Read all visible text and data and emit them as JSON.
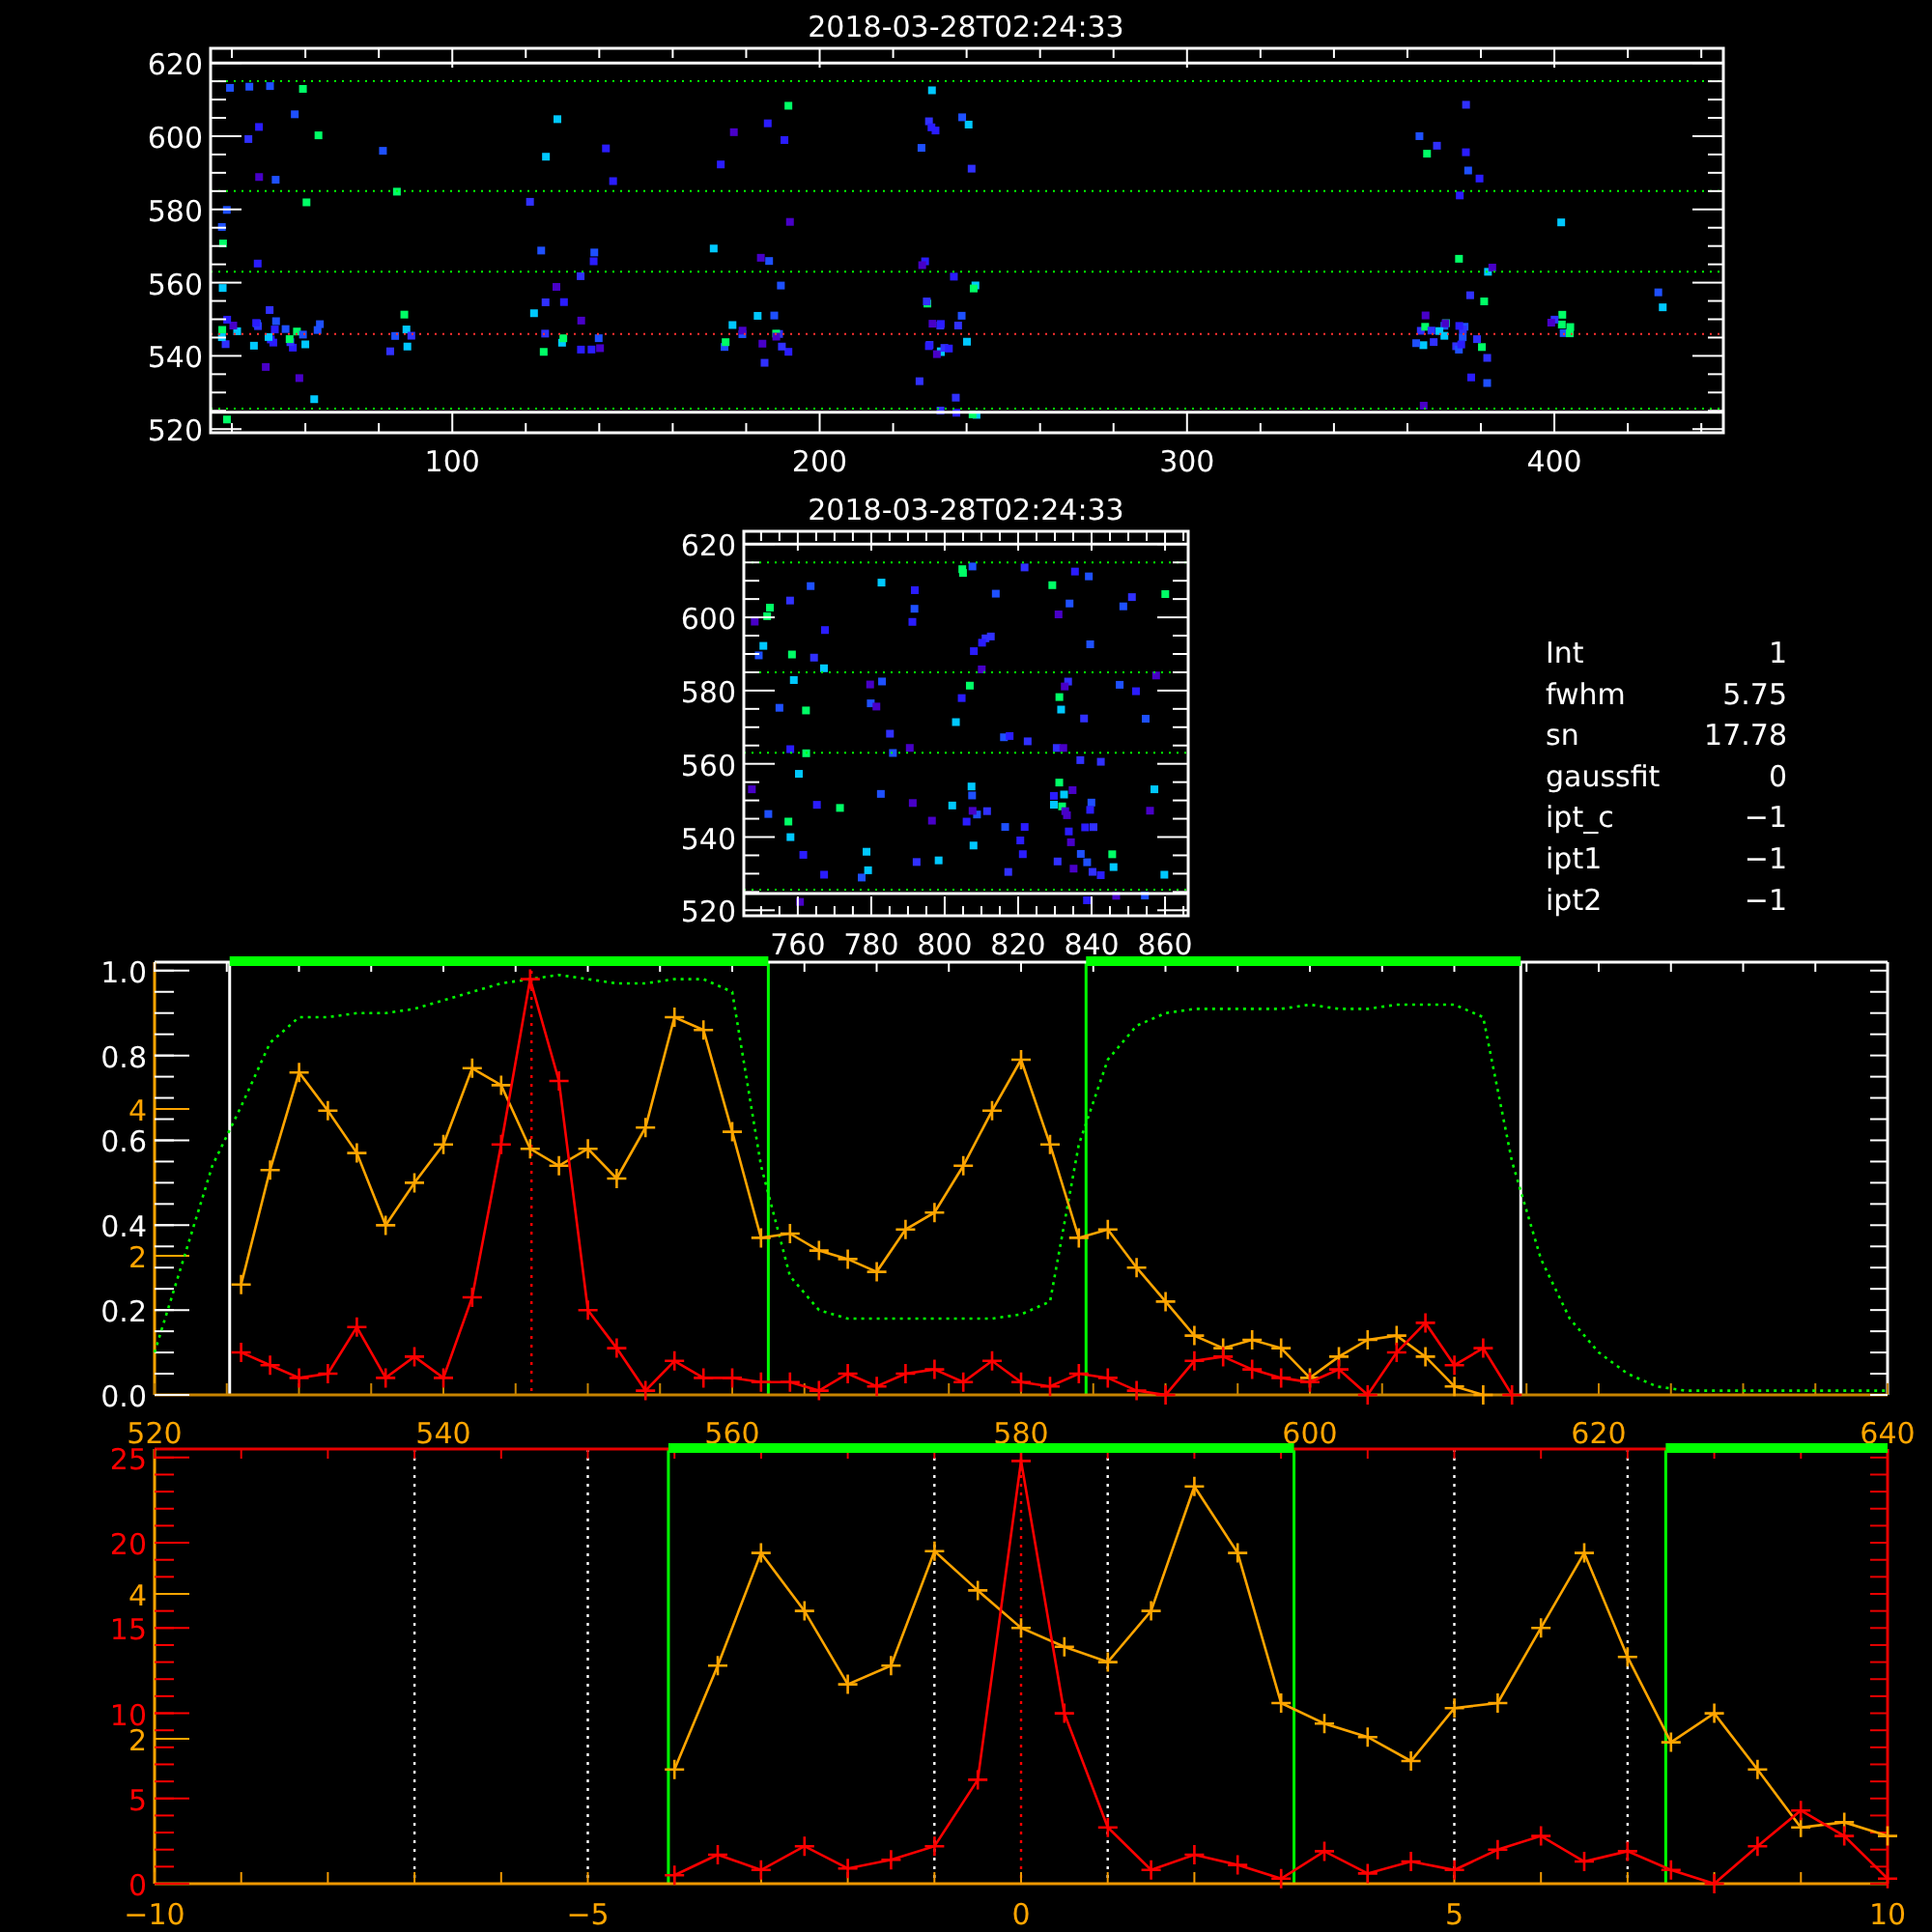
{
  "image_panels": [
    {
      "title": "2018-03-28T02:24:33",
      "xtick_labels": [
        "100",
        "200",
        "300",
        "400"
      ],
      "ytick_labels": [
        "620",
        "600",
        "580",
        "560",
        "540",
        "520"
      ]
    },
    {
      "title": "2018-03-28T02:24:33",
      "xtick_labels": [
        "760",
        "780",
        "800",
        "820",
        "840",
        "860"
      ],
      "ytick_labels": [
        "620",
        "600",
        "580",
        "560",
        "540",
        "520"
      ]
    }
  ],
  "fit_info": [
    {
      "label": "Int",
      "value": "1"
    },
    {
      "label": "fwhm",
      "value": "5.75"
    },
    {
      "label": "sn",
      "value": "17.78"
    },
    {
      "label": "gaussfit",
      "value": "0"
    },
    {
      "label": "ipt_c",
      "value": "−1"
    },
    {
      "label": "ipt1",
      "value": "−1"
    },
    {
      "label": "ipt2",
      "value": "−1"
    }
  ],
  "profile_plots": [
    {
      "secondary_ytick_labels": [
        "4",
        "2"
      ],
      "chart_data": {
        "type": "line",
        "xlim": [
          520,
          640
        ],
        "ylim": [
          0,
          1.02
        ],
        "xticks": [
          {
            "value": 520,
            "label": "520"
          },
          {
            "value": 540,
            "label": "540"
          },
          {
            "value": 560,
            "label": "560"
          },
          {
            "value": 580,
            "label": "580"
          },
          {
            "value": 600,
            "label": "600"
          },
          {
            "value": 620,
            "label": "620"
          },
          {
            "value": 640,
            "label": "640"
          }
        ],
        "yticks": [
          {
            "value": 1,
            "label": "1.0"
          },
          {
            "value": 0.8,
            "label": "0.8"
          },
          {
            "value": 0.6,
            "label": "0.6"
          },
          {
            "value": 0.4,
            "label": "0.4"
          },
          {
            "value": 0.2,
            "label": "0.2"
          },
          {
            "value": 0,
            "label": "0.0"
          }
        ],
        "x": [
          520,
          522,
          524,
          526,
          528,
          530,
          532,
          534,
          536,
          538,
          540,
          542,
          544,
          546,
          548,
          550,
          552,
          554,
          556,
          558,
          560,
          562,
          564,
          566,
          568,
          570,
          572,
          574,
          576,
          578,
          580,
          582,
          584,
          586,
          588,
          590,
          592,
          594,
          596,
          598,
          600,
          602,
          604,
          606,
          608,
          610,
          612,
          614,
          616,
          618,
          620,
          622,
          624,
          626,
          628,
          630,
          632,
          634,
          636,
          638,
          640
        ],
        "series": [
          {
            "color": "#00ff00",
            "line_style": "dotted",
            "values": [
              0.1,
              0.32,
              0.54,
              0.68,
              0.83,
              0.89,
              0.89,
              0.9,
              0.9,
              0.91,
              0.93,
              0.95,
              0.97,
              0.98,
              0.99,
              0.98,
              0.97,
              0.97,
              0.98,
              0.98,
              0.95,
              0.54,
              0.28,
              0.2,
              0.18,
              0.18,
              0.18,
              0.18,
              0.18,
              0.18,
              0.19,
              0.22,
              0.59,
              0.79,
              0.87,
              0.9,
              0.91,
              0.91,
              0.91,
              0.91,
              0.92,
              0.91,
              0.91,
              0.92,
              0.92,
              0.92,
              0.89,
              0.55,
              0.32,
              0.18,
              0.1,
              0.05,
              0.02,
              0.01,
              0.01,
              0.01,
              0.01,
              0.01,
              0.01,
              0.01,
              0.01
            ]
          },
          {
            "color": "#ffa500",
            "marker": "+",
            "values": [
              null,
              null,
              null,
              0.26,
              0.53,
              0.76,
              0.67,
              0.57,
              0.4,
              0.5,
              0.59,
              0.77,
              0.73,
              0.58,
              0.54,
              0.58,
              0.51,
              0.63,
              0.89,
              0.86,
              0.62,
              0.37,
              0.38,
              0.34,
              0.32,
              0.29,
              0.39,
              0.43,
              0.54,
              0.67,
              0.79,
              0.59,
              0.37,
              0.39,
              0.3,
              0.22,
              0.14,
              0.11,
              0.13,
              0.11,
              0.04,
              0.09,
              0.13,
              0.14,
              0.09,
              0.02,
              0,
              null,
              null,
              null,
              null,
              null,
              null,
              null,
              null,
              null,
              null,
              null,
              null,
              null,
              null
            ]
          },
          {
            "color": "#ff0000",
            "marker": "+",
            "values": [
              null,
              null,
              null,
              0.1,
              0.07,
              0.04,
              0.05,
              0.16,
              0.04,
              0.09,
              0.04,
              0.23,
              0.59,
              0.98,
              0.74,
              0.2,
              0.11,
              0.01,
              0.08,
              0.04,
              0.04,
              0.03,
              0.03,
              0.01,
              0.05,
              0.02,
              0.05,
              0.06,
              0.03,
              0.08,
              0.03,
              0.02,
              0.05,
              0.04,
              0.01,
              0,
              0.08,
              0.09,
              0.06,
              0.04,
              0.03,
              0.06,
              0,
              0.1,
              0.17,
              0.07,
              0.11,
              0,
              null,
              null,
              null,
              null,
              null,
              null,
              null,
              null,
              null,
              null,
              null,
              null,
              null
            ]
          }
        ],
        "ref_lines": [
          {
            "axis": "x",
            "value": 525.2,
            "color": "#ffffff",
            "line_style": "solid"
          },
          {
            "axis": "x",
            "value": 614.6,
            "color": "#ffffff",
            "line_style": "solid"
          },
          {
            "axis": "x",
            "value": 562.5,
            "color": "#00ff00",
            "line_style": "solid"
          },
          {
            "axis": "x",
            "value": 584.5,
            "color": "#00ff00",
            "line_style": "solid"
          },
          {
            "axis": "x",
            "value": 546.1,
            "color": "#ff0000",
            "line_style": "dotted"
          }
        ]
      }
    },
    {
      "secondary_ytick_labels": [
        "4",
        "2"
      ],
      "chart_data": {
        "type": "line",
        "xlim": [
          -10,
          10
        ],
        "ylim": [
          0,
          25.5
        ],
        "xticks": [
          {
            "value": -10,
            "label": "−10"
          },
          {
            "value": -5,
            "label": "−5"
          },
          {
            "value": 0,
            "label": "0"
          },
          {
            "value": 5,
            "label": "5"
          },
          {
            "value": 10,
            "label": "10"
          }
        ],
        "yticks": [
          {
            "value": 25,
            "label": "25"
          },
          {
            "value": 20,
            "label": "20"
          },
          {
            "value": 15,
            "label": "15"
          },
          {
            "value": 10,
            "label": "10"
          },
          {
            "value": 5,
            "label": "5"
          },
          {
            "value": 0,
            "label": "0"
          }
        ],
        "x": [
          -4,
          -3.5,
          -3,
          -2.5,
          -2,
          -1.5,
          -1,
          -0.5,
          0,
          0.5,
          1,
          1.5,
          2,
          2.5,
          3,
          3.5,
          4,
          4.5,
          5,
          5.5,
          6,
          6.5,
          7,
          7.5,
          8,
          8.5,
          9,
          9.5,
          10
        ],
        "series": [
          {
            "color": "#ffa500",
            "marker": "+",
            "values": [
              6.7,
              12.8,
              19.4,
              16,
              11.7,
              12.8,
              19.5,
              17.2,
              15,
              13.9,
              13,
              16,
              23.3,
              19.4,
              10.6,
              9.4,
              8.6,
              7.2,
              10.3,
              10.6,
              15,
              19.4,
              13.3,
              8.3,
              10,
              6.7,
              3.3,
              3.6,
              2.8
            ]
          },
          {
            "color": "#ff0000",
            "marker": "+",
            "values": [
              0.5,
              1.7,
              0.8,
              2.2,
              0.9,
              1.4,
              2.2,
              6.1,
              24.8,
              10,
              3.3,
              0.8,
              1.7,
              1.1,
              0.3,
              1.9,
              0.6,
              1.3,
              0.8,
              2,
              2.8,
              1.3,
              1.9,
              0.8,
              0,
              2.2,
              4.3,
              2.8,
              0.3
            ]
          }
        ],
        "ref_lines": [
          {
            "axis": "x",
            "value": -7,
            "color": "#ffffff",
            "line_style": "dotted"
          },
          {
            "axis": "x",
            "value": -5,
            "color": "#ffffff",
            "line_style": "dotted"
          },
          {
            "axis": "x",
            "value": -1,
            "color": "#ffffff",
            "line_style": "dotted"
          },
          {
            "axis": "x",
            "value": 1,
            "color": "#ffffff",
            "line_style": "dotted"
          },
          {
            "axis": "x",
            "value": 5,
            "color": "#ffffff",
            "line_style": "dotted"
          },
          {
            "axis": "x",
            "value": 7,
            "color": "#ffffff",
            "line_style": "dotted"
          },
          {
            "axis": "x",
            "value": 0,
            "color": "#ff0000",
            "line_style": "dotted"
          },
          {
            "axis": "x",
            "value": -4.07,
            "color": "#00ff00",
            "line_style": "solid"
          },
          {
            "axis": "x",
            "value": 3.15,
            "color": "#00ff00",
            "line_style": "solid"
          },
          {
            "axis": "x",
            "value": 7.44,
            "color": "#00ff00",
            "line_style": "solid"
          }
        ]
      }
    }
  ]
}
